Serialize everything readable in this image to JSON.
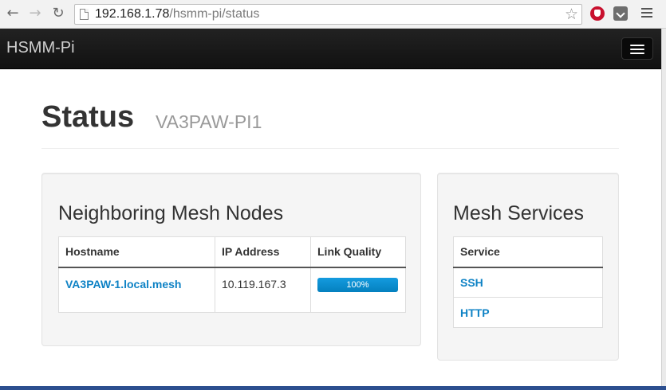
{
  "browser": {
    "url_host": "192.168.1.78",
    "url_path": "/hsmm-pi/status"
  },
  "navbar": {
    "brand": "HSMM-Pi"
  },
  "page": {
    "title": "Status",
    "subtitle": "VA3PAW-PI1"
  },
  "neighbors": {
    "heading": "Neighboring Mesh Nodes",
    "columns": [
      "Hostname",
      "IP Address",
      "Link Quality"
    ],
    "rows": [
      {
        "hostname": "VA3PAW-1.local.mesh",
        "ip": "10.119.167.3",
        "link_quality": "100%",
        "link_quality_value": 1.0
      }
    ]
  },
  "services": {
    "heading": "Mesh Services",
    "column": "Service",
    "items": [
      "SSH",
      "HTTP"
    ]
  },
  "colors": {
    "link": "#0e82c5",
    "progress": "#149bdf",
    "navbar": "#1a1a1a"
  }
}
